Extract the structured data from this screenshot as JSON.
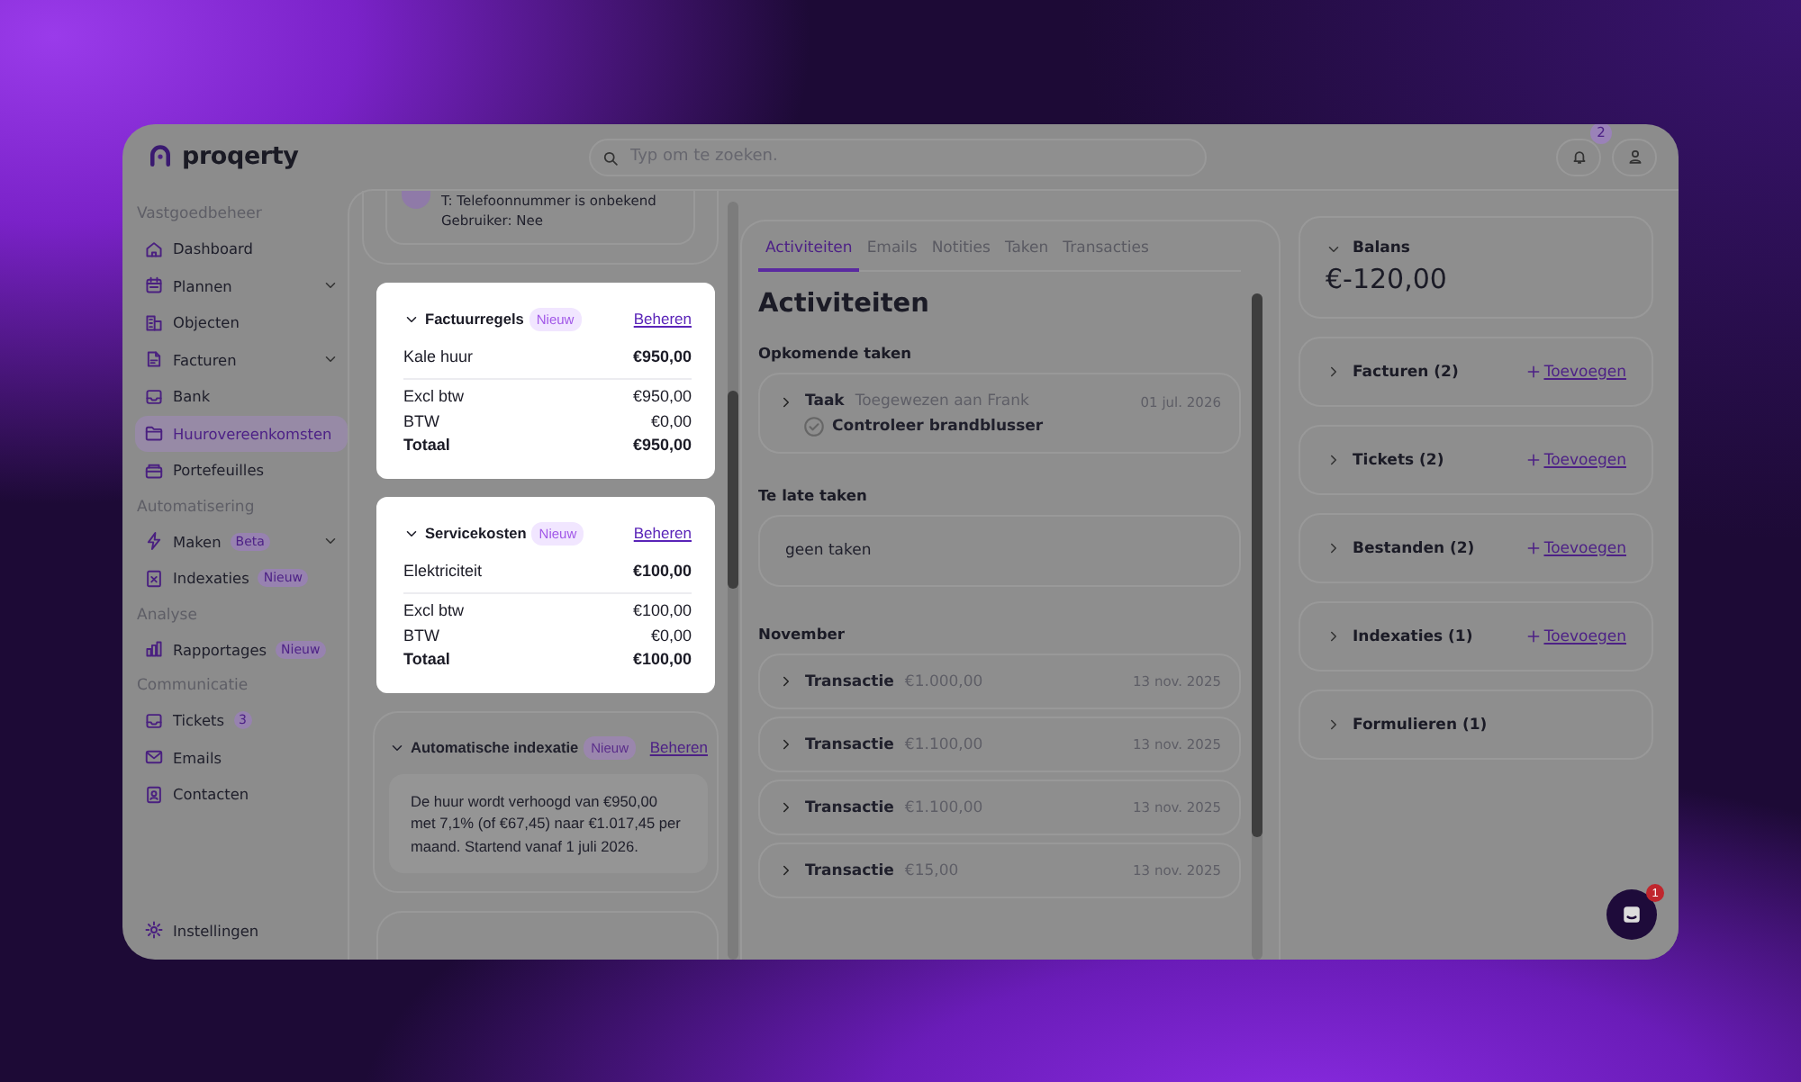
{
  "header": {
    "logo": "proqerty",
    "search": {
      "placeholder": "Typ om te zoeken."
    },
    "notifications": "2"
  },
  "sidebar": {
    "sections": [
      {
        "title": "Vastgoedbeheer",
        "items": [
          {
            "label": "Dashboard",
            "selected": false,
            "has_submenu": false
          },
          {
            "label": "Plannen",
            "selected": false,
            "has_submenu": true
          },
          {
            "label": "Objecten",
            "selected": false,
            "has_submenu": false
          },
          {
            "label": "Facturen",
            "selected": false,
            "has_submenu": true
          },
          {
            "label": "Bank",
            "selected": false,
            "has_submenu": false
          },
          {
            "label": "Huurovereenkomsten",
            "selected": true,
            "has_submenu": false
          },
          {
            "label": "Portefeuilles",
            "selected": false,
            "has_submenu": false
          }
        ]
      },
      {
        "title": "Automatisering",
        "items": [
          {
            "label": "Maken",
            "badge": "Beta",
            "selected": false,
            "has_submenu": true
          },
          {
            "label": "Indexaties",
            "badge": "Nieuw",
            "selected": false,
            "has_submenu": false
          }
        ]
      },
      {
        "title": "Analyse",
        "items": [
          {
            "label": "Rapportages",
            "badge": "Nieuw",
            "selected": false,
            "has_submenu": false
          }
        ]
      },
      {
        "title": "Communicatie",
        "items": [
          {
            "label": "Tickets",
            "badge": "3",
            "selected": false,
            "has_submenu": false
          },
          {
            "label": "Emails",
            "selected": false,
            "has_submenu": false
          },
          {
            "label": "Contacten",
            "selected": false,
            "has_submenu": false
          }
        ]
      }
    ],
    "footer": {
      "label": "Instellingen"
    }
  },
  "contact": {
    "lines": [
      "T: Telefoonnummer is onbekend",
      "Gebruiker: Nee"
    ]
  },
  "cards": [
    {
      "kind": "lines",
      "title": "Factuurregels",
      "badge": "Nieuw",
      "action": "Beheren",
      "highlighted": true,
      "expanded": true,
      "lines": [
        {
          "label": "Kale huur",
          "amount": "€950,00"
        }
      ],
      "totals": [
        {
          "label": "Excl btw",
          "amount": "€950,00",
          "bold": false
        },
        {
          "label": "BTW",
          "amount": "€0,00",
          "bold": false
        },
        {
          "label": "Totaal",
          "amount": "€950,00",
          "bold": true
        }
      ]
    },
    {
      "kind": "lines",
      "title": "Servicekosten",
      "badge": "Nieuw",
      "action": "Beheren",
      "highlighted": true,
      "expanded": true,
      "lines": [
        {
          "label": "Elektriciteit",
          "amount": "€100,00"
        }
      ],
      "totals": [
        {
          "label": "Excl btw",
          "amount": "€100,00",
          "bold": false
        },
        {
          "label": "BTW",
          "amount": "€0,00",
          "bold": false
        },
        {
          "label": "Totaal",
          "amount": "€100,00",
          "bold": true
        }
      ]
    },
    {
      "kind": "note",
      "title": "Automatische indexatie",
      "badge": "Nieuw",
      "action": "Beheren",
      "highlighted": false,
      "expanded": true,
      "note": "De huur wordt verhoogd van €950,00 met 7,1% (of €67,45) naar €1.017,45 per maand. Startend vanaf 1 juli 2026."
    }
  ],
  "activity": {
    "tabs": [
      {
        "label": "Activiteiten",
        "selected": true
      },
      {
        "label": "Emails",
        "selected": false
      },
      {
        "label": "Notities",
        "selected": false
      },
      {
        "label": "Taken",
        "selected": false
      },
      {
        "label": "Transacties",
        "selected": false
      }
    ],
    "heading": "Activiteiten",
    "upcoming": {
      "title": "Opkomende taken",
      "tasks": [
        {
          "type": "Taak",
          "assignee": "Toegewezen aan Frank",
          "date": "01 jul. 2026",
          "title": "Controleer brandblusser",
          "done": false
        }
      ]
    },
    "overdue": {
      "title": "Te late taken",
      "empty": "geen taken"
    },
    "month": {
      "title": "November",
      "items": [
        {
          "type": "Transactie",
          "amount": "€1.000,00",
          "date": "13 nov. 2025"
        },
        {
          "type": "Transactie",
          "amount": "€1.100,00",
          "date": "13 nov. 2025"
        },
        {
          "type": "Transactie",
          "amount": "€1.100,00",
          "date": "13 nov. 2025"
        },
        {
          "type": "Transactie",
          "amount": "€15,00",
          "date": "13 nov. 2025"
        }
      ]
    }
  },
  "summary": {
    "balance": {
      "title": "Balans",
      "amount": "€-120,00",
      "expanded": true
    },
    "panels": [
      {
        "title": "Facturen (2)",
        "action": "Toevoegen",
        "expanded": false
      },
      {
        "title": "Tickets (2)",
        "action": "Toevoegen",
        "expanded": false
      },
      {
        "title": "Bestanden (2)",
        "action": "Toevoegen",
        "expanded": false
      },
      {
        "title": "Indexaties (1)",
        "action": "Toevoegen",
        "expanded": false
      },
      {
        "title": "Formulieren (1)",
        "expanded": false
      }
    ]
  },
  "chat": {
    "badge": "1"
  }
}
